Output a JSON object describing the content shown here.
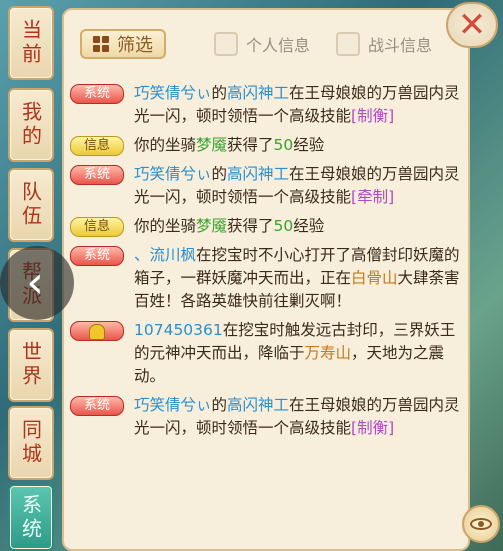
{
  "tabs": [
    {
      "label": "当前"
    },
    {
      "label": "我的"
    },
    {
      "label": "队伍"
    },
    {
      "label": "帮派"
    },
    {
      "label": "世界"
    },
    {
      "label": "同城"
    },
    {
      "label": "系统",
      "active": true
    }
  ],
  "toolbar": {
    "filter_label": "筛选",
    "personal_info": "个人信息",
    "battle_info": "战斗信息"
  },
  "badges": {
    "system": "系统",
    "info": "信息"
  },
  "messages": [
    {
      "p1": "巧笑倩兮ぃ",
      "p2": "的",
      "p3": "高闪神工",
      "p4": "在王母娘娘的万兽园内灵光一闪，顿时领悟一个高级技能",
      "p5": "[制衡]"
    },
    {
      "p1": "你的坐骑",
      "p2": "梦魇",
      "p3": "获得了",
      "p4": "50",
      "p5": "经验"
    },
    {
      "p1": "巧笑倩兮ぃ",
      "p2": "的",
      "p3": "高闪神工",
      "p4": "在王母娘娘的万兽园内灵光一闪，顿时领悟一个高级技能",
      "p5": "[牵制]"
    },
    {
      "p1": "你的坐骑",
      "p2": "梦魇",
      "p3": "获得了",
      "p4": "50",
      "p5": "经验"
    },
    {
      "p1": "、流川枫",
      "p2": "在挖宝时不小心打开了高僧封印妖魔的箱子，一群妖魔冲天而出，正在",
      "p3": "白骨山",
      "p4": "大肆荼害百姓！各路英雄快前往剿灭啊！"
    },
    {
      "p1": "107450361",
      "p2": "在挖宝时触发远古封印，三界妖王的元神冲天而出，降临于",
      "p3": "万寿山",
      "p4": "，天地为之震动。"
    },
    {
      "p1": "巧笑倩兮ぃ",
      "p2": "的",
      "p3": "高闪神工",
      "p4": "在王母娘娘的万兽园内灵光一闪，顿时领悟一个高级技能",
      "p5": "[制衡]"
    }
  ],
  "icons": {
    "close": "close-icon",
    "filter": "grid-icon",
    "back": "chevron-left-icon",
    "eye": "eye-icon",
    "bell": "bell-icon"
  }
}
